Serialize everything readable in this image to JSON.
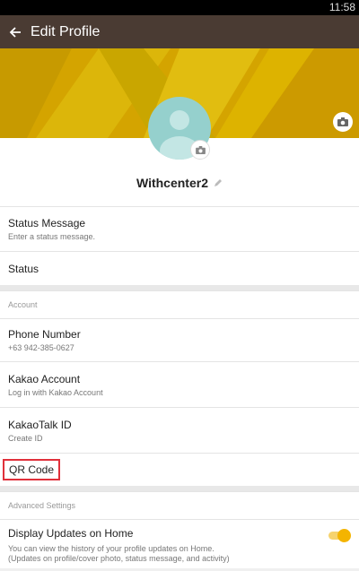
{
  "status_bar": {
    "time": "11:58"
  },
  "app_bar": {
    "title": "Edit Profile",
    "back_icon": "arrow-back-icon"
  },
  "profile": {
    "name": "Withcenter2"
  },
  "rows": {
    "status_message": {
      "title": "Status Message",
      "subtitle": "Enter a status message."
    },
    "status": {
      "title": "Status"
    },
    "account_header": "Account",
    "phone_number": {
      "title": "Phone Number",
      "subtitle": "+63 942-385-0627"
    },
    "kakao_account": {
      "title": "Kakao Account",
      "subtitle": "Log in with Kakao Account"
    },
    "kakaotalk_id": {
      "title": "KakaoTalk ID",
      "subtitle": "Create ID"
    },
    "qr_code": {
      "title": "QR Code"
    },
    "advanced_header": "Advanced Settings",
    "display_updates": {
      "title": "Display Updates on Home",
      "subtitle_line1": "You can view the history of your profile updates on Home.",
      "subtitle_line2": "(Updates on profile/cover photo, status message, and activity)",
      "toggle_on": true
    }
  },
  "colors": {
    "appbar": "#4a3b33",
    "cover": "#d6a900",
    "avatar": "#95d0cd",
    "toggle": "#f4b400",
    "highlight": "#e0303a"
  }
}
